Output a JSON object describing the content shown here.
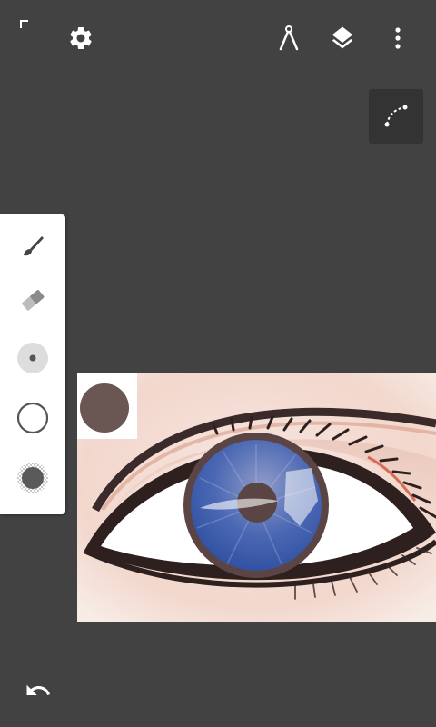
{
  "toolbar": {
    "left": [
      "settings-icon"
    ],
    "right": [
      "ruler-icon",
      "layers-icon",
      "more-vert-icon"
    ]
  },
  "tools": [
    {
      "name": "brush",
      "icon": "brush-icon"
    },
    {
      "name": "eraser",
      "icon": "eraser-icon"
    },
    {
      "name": "brush-size",
      "icon": "brush-size-icon"
    },
    {
      "name": "opacity",
      "icon": "opacity-circle-icon"
    },
    {
      "name": "color",
      "icon": "color-circle-icon"
    }
  ],
  "curve_tool": {
    "icon": "curve-icon"
  },
  "undo": {
    "icon": "undo-icon"
  },
  "colors": {
    "background": "#424242",
    "current_swatch": "#6a5652",
    "iris": "#3a5ca8",
    "panel": "#ffffff"
  }
}
